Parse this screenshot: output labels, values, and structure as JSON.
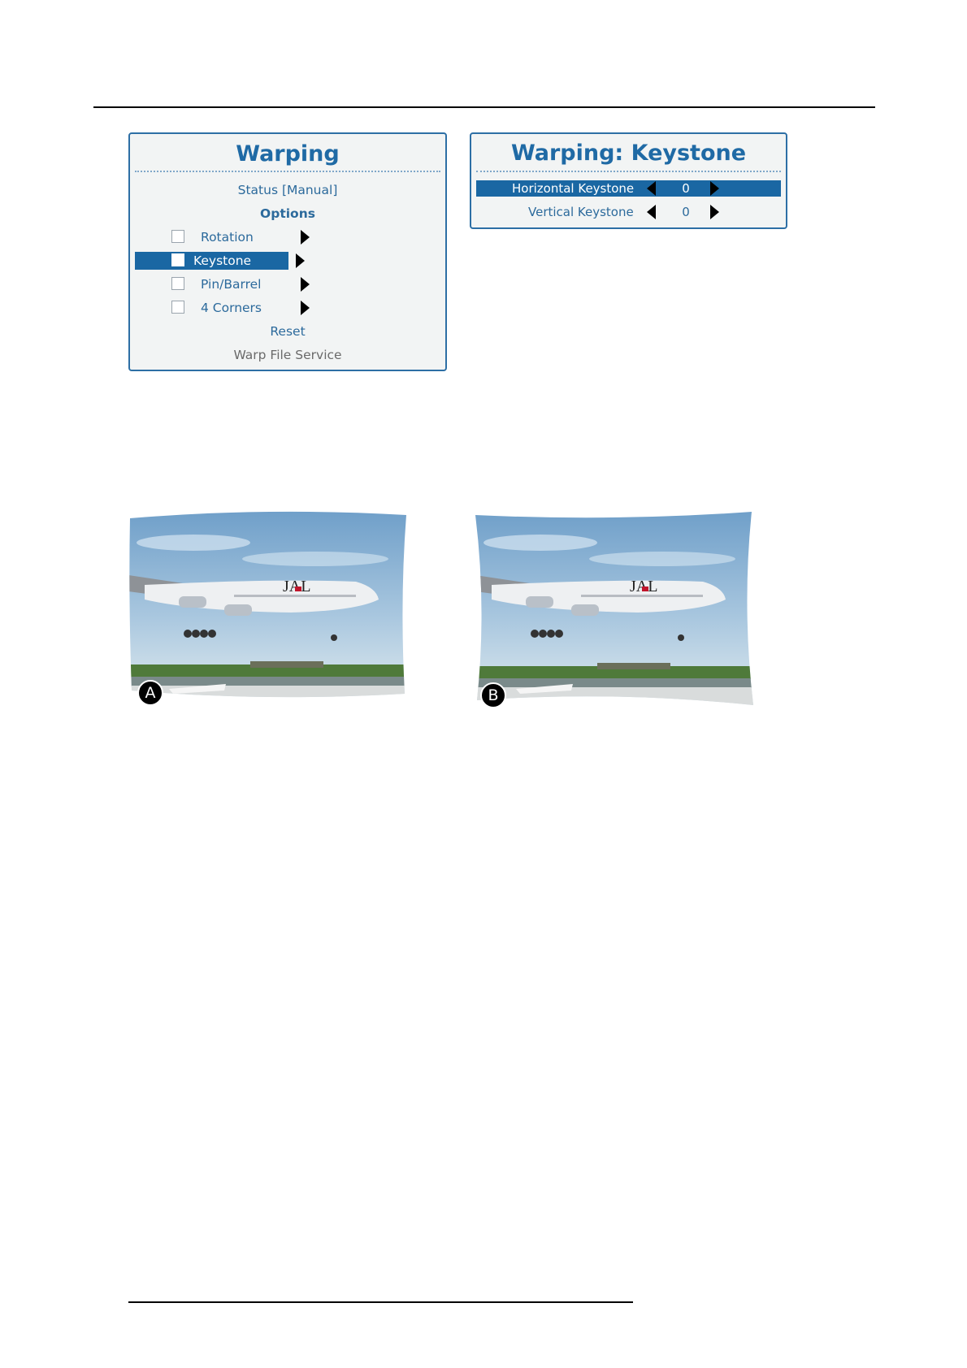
{
  "warping_menu": {
    "title": "Warping",
    "status": "Status [Manual]",
    "options_header": "Options",
    "options": [
      {
        "label": "Rotation",
        "selected": false
      },
      {
        "label": "Keystone",
        "selected": true
      },
      {
        "label": "Pin/Barrel",
        "selected": false
      },
      {
        "label": "4 Corners",
        "selected": false
      }
    ],
    "reset": "Reset",
    "warp_file_service": "Warp File Service"
  },
  "keystone_menu": {
    "title": "Warping: Keystone",
    "rows": [
      {
        "label": "Horizontal Keystone",
        "value": "0",
        "selected": true
      },
      {
        "label": "Vertical Keystone",
        "value": "0",
        "selected": false
      }
    ]
  },
  "images": [
    {
      "badge": "A",
      "icon": "airplane-landing-photo"
    },
    {
      "badge": "B",
      "icon": "airplane-landing-photo"
    }
  ],
  "colors": {
    "accent": "#1a67a3",
    "title": "#1f6aa5",
    "panel_bg": "#f2f4f4",
    "panel_border": "#2d6fa5"
  }
}
